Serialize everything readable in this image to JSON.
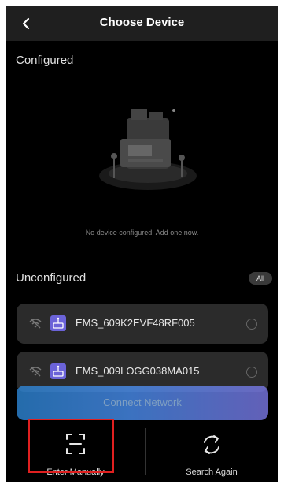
{
  "header": {
    "title": "Choose Device",
    "back_icon": "chevron-left-icon"
  },
  "configured": {
    "title": "Configured",
    "empty_message": "No device configured. Add one now.",
    "illustration_icon": "empty-devices-illustration"
  },
  "unconfigured": {
    "title": "Unconfigured",
    "filter_label": "All",
    "devices": [
      {
        "name": "EMS_609K2EVF48RF005",
        "wifi_icon": "wifi-off-icon",
        "device_icon": "router-icon"
      },
      {
        "name": "EMS_009LOGG038MA015",
        "wifi_icon": "wifi-off-icon",
        "device_icon": "router-icon"
      }
    ]
  },
  "connect_button": {
    "label": "Connect Network"
  },
  "bottom_actions": [
    {
      "label": "Enter Manually",
      "icon": "scan-icon"
    },
    {
      "label": "Search Again",
      "icon": "refresh-icon"
    }
  ],
  "colors": {
    "background": "#000000",
    "card": "#2b2b2b",
    "accent_start": "#2d86d6",
    "accent_end": "#7b78e6",
    "device_icon": "#6b63d8",
    "highlight": "#e02020"
  }
}
